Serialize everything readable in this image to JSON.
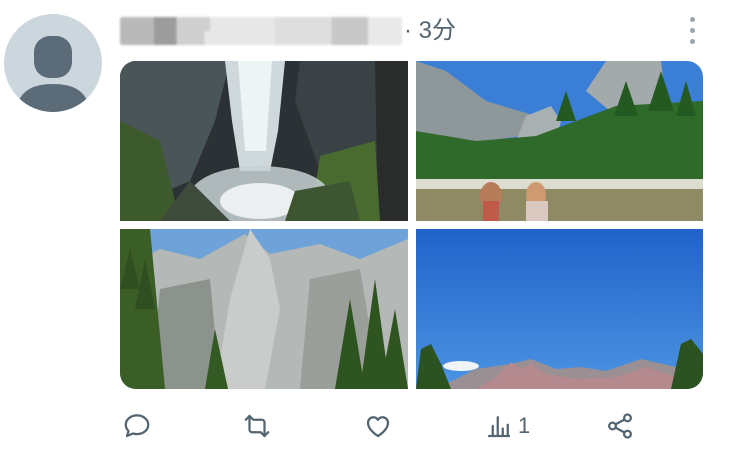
{
  "post": {
    "time": "· 3分"
  },
  "actions": {
    "views_count": "1"
  },
  "colors": {
    "icon": "#536471",
    "avatar_bg": "#ccd6dd",
    "avatar_fg": "#5b6b78"
  },
  "icons": [
    "person-icon",
    "more-vertical-icon",
    "reply-icon",
    "retweet-icon",
    "heart-icon",
    "views-icon",
    "share-icon"
  ]
}
